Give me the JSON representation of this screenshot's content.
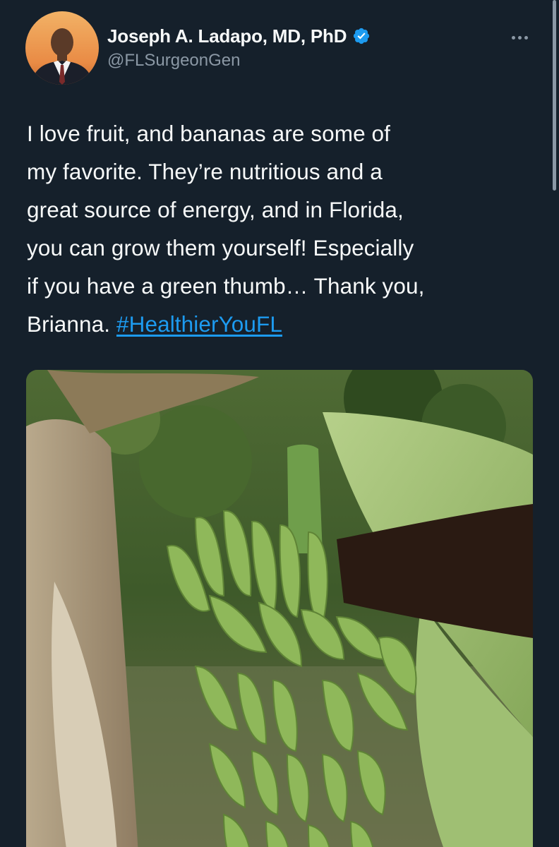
{
  "author": {
    "display_name": "Joseph A. Ladapo, MD, PhD",
    "handle": "@FLSurgeonGen",
    "verified": true,
    "avatar_icon": "profile-photo"
  },
  "tweet": {
    "text_lines": [
      "I love fruit, and bananas are some of",
      "my favorite. They’re nutritious and a",
      "great source of energy, and in Florida,",
      "you can grow them yourself! Especially",
      "if you have a green thumb… Thank you,"
    ],
    "last_line_prefix": "Brianna. ",
    "hashtag": "#HealthierYouFL"
  },
  "media": {
    "icon": "banana-bunch-photo"
  },
  "colors": {
    "background": "#15202b",
    "text": "#f7f9f9",
    "secondary": "#8b98a5",
    "link": "#1d9bf0"
  }
}
